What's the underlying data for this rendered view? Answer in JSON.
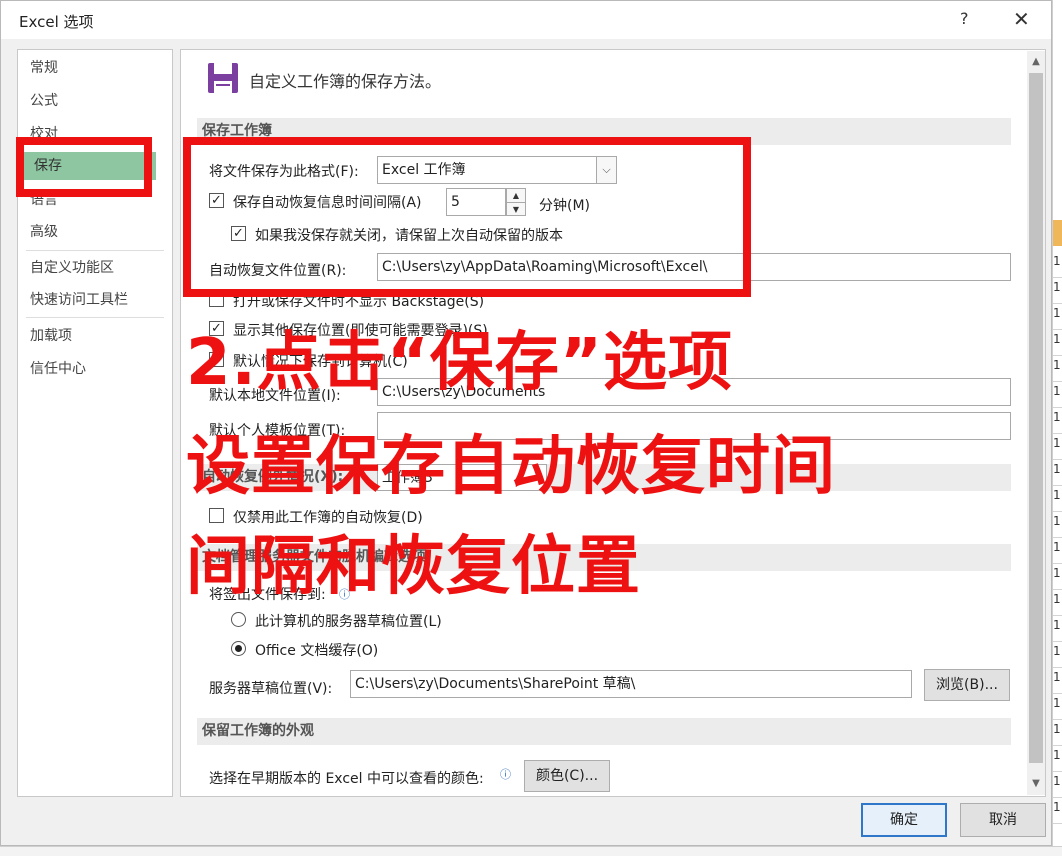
{
  "window": {
    "title": "Excel 选项",
    "help": "?",
    "close": "✕"
  },
  "background": {
    "right_cells": [
      "1",
      "1",
      "1",
      "1",
      "1",
      "1",
      "1",
      "1",
      "1",
      "1",
      "1",
      "1",
      "1",
      "1",
      "1",
      "1",
      "1",
      "1",
      "1",
      "1",
      "1",
      "1"
    ]
  },
  "nav": {
    "items": [
      {
        "label": "常规"
      },
      {
        "label": "公式"
      },
      {
        "label": "校对"
      },
      {
        "label": "保存",
        "active": true
      },
      {
        "label": "语言"
      },
      {
        "label": "高级"
      },
      {
        "label": "自定义功能区"
      },
      {
        "label": "快速访问工具栏"
      },
      {
        "label": "加载项"
      },
      {
        "label": "信任中心"
      }
    ]
  },
  "content": {
    "header": "自定义工作簿的保存方法。",
    "section1": "保存工作簿",
    "format_label": "将文件保存为此格式(F):",
    "format_value": "Excel 工作簿",
    "autorecover_label": "保存自动恢复信息时间间隔(A)",
    "autorecover_minutes": "5",
    "minutes_unit": "分钟(M)",
    "keep_last_label": "如果我没保存就关闭，请保留上次自动保留的版本",
    "autorecover_location_label": "自动恢复文件位置(R):",
    "autorecover_location_value": "C:\\Users\\zy\\AppData\\Roaming\\Microsoft\\Excel\\",
    "backstage_label": "打开或保存文件时不显示 Backstage(S)",
    "show_other_label": "显示其他保存位置(即使可能需要登录)(S)",
    "default_local_label": "默认情况下保存到计算机(C)",
    "default_local_path_label": "默认本地文件位置(I):",
    "default_local_path_value": "C:\\Users\\zy\\Documents",
    "template_label": "默认个人模板位置(T):",
    "template_value": "",
    "section2": "自动恢复例外情况(X):",
    "section2_value": "工作簿3",
    "disable_autorecover_label": "仅禁用此工作簿的自动恢复(D)",
    "section3": "文档管理服务器文件的脱机编辑选项",
    "save_checked_out_label": "将签出文件保存到:",
    "radio_server_label": "此计算机的服务器草稿位置(L)",
    "radio_office_label": "Office 文档缓存(O)",
    "server_drafts_label": "服务器草稿位置(V):",
    "server_drafts_value": "C:\\Users\\zy\\Documents\\SharePoint 草稿\\",
    "browse": "浏览(B)...",
    "section4": "保留工作簿的外观",
    "colors_label": "选择在早期版本的 Excel 中可以查看的颜色:",
    "colors_button": "颜色(C)..."
  },
  "footer": {
    "ok": "确定",
    "cancel": "取消"
  },
  "annotation": {
    "line1": "2.点击“保存”选项",
    "line2": "设置保存自动恢复时间",
    "line3": "间隔和恢复位置"
  },
  "colors": {
    "accent_red": "#ee1111",
    "nav_active": "#8dc6a1",
    "save_icon": "#7b3fa0"
  }
}
